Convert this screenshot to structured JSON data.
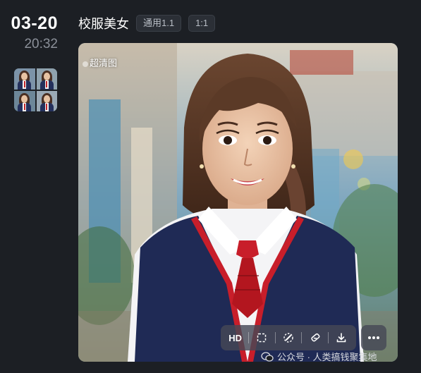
{
  "date": {
    "day": "03-20",
    "time": "20:32"
  },
  "thumbnails": [
    {
      "bg": "#7c93a8"
    },
    {
      "bg": "#8fa2ae"
    },
    {
      "bg": "#6d8799"
    },
    {
      "bg": "#9aa9b5"
    }
  ],
  "header": {
    "title": "校服美女",
    "tags": [
      "通用1.1",
      "1:1"
    ]
  },
  "image": {
    "quality_label": "超清图"
  },
  "toolbar": {
    "hd_label": "HD"
  },
  "watermark": {
    "text": "公众号 · 人类搞钱聚集地"
  },
  "colors": {
    "background": "#1c1f24",
    "tag_bg": "#2b2f36",
    "uniform": "#1f2a55",
    "tie": "#c81e2a"
  }
}
